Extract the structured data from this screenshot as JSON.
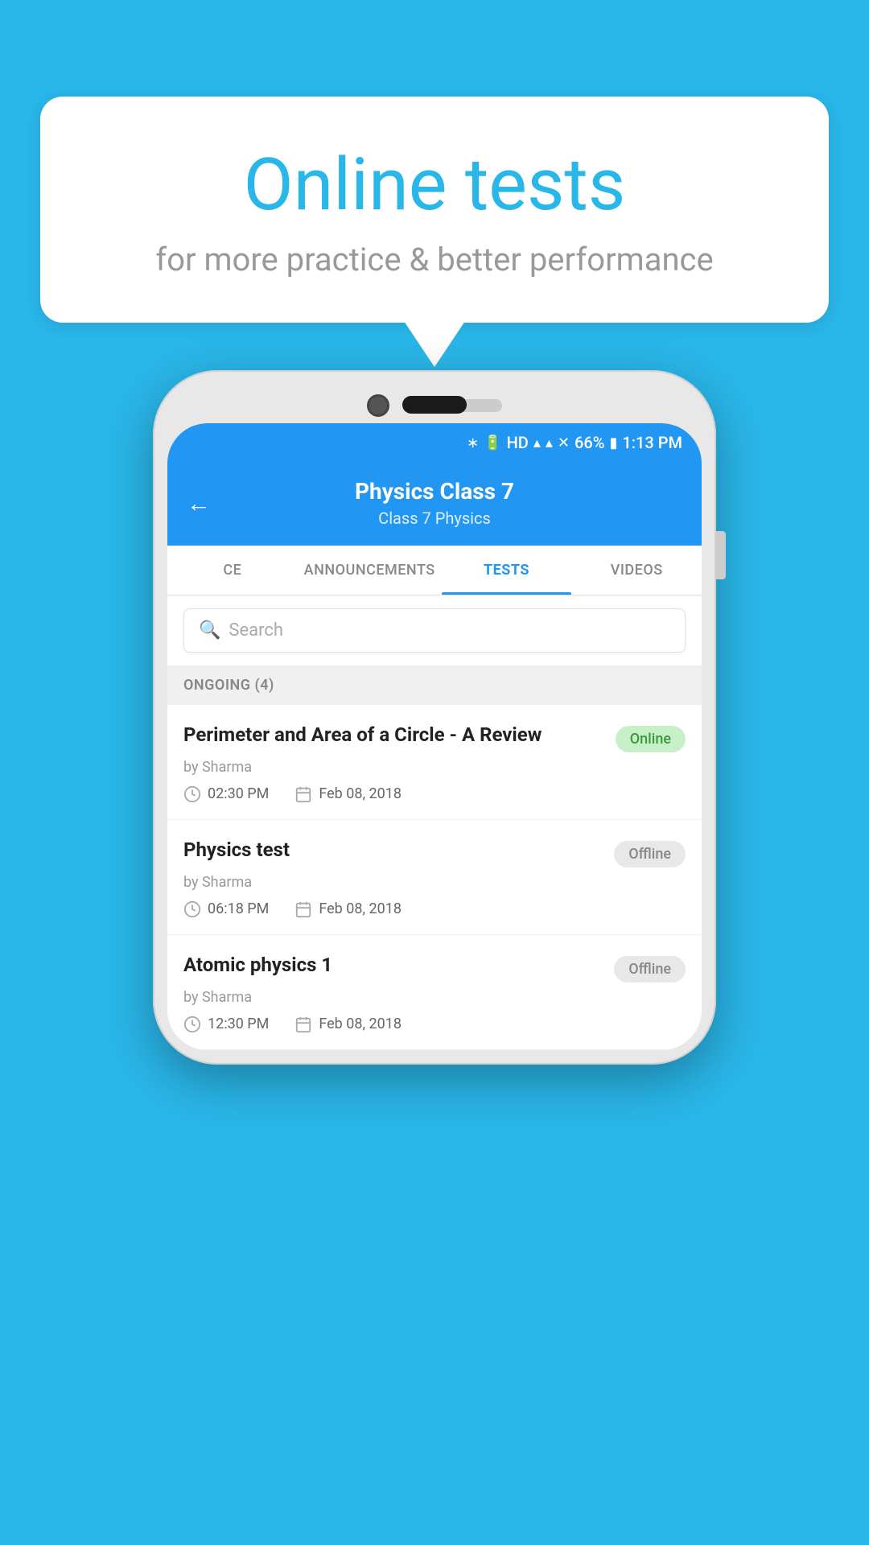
{
  "background": {
    "color": "#29b6e8"
  },
  "speech_bubble": {
    "title": "Online tests",
    "subtitle": "for more practice & better performance"
  },
  "phone": {
    "status_bar": {
      "battery": "66%",
      "time": "1:13 PM",
      "icons": [
        "bluetooth",
        "vibrate",
        "hd",
        "wifi",
        "signal",
        "x-signal",
        "battery"
      ]
    },
    "header": {
      "back_label": "←",
      "title": "Physics Class 7",
      "subtitle": "Class 7   Physics"
    },
    "tabs": [
      {
        "label": "CE",
        "active": false
      },
      {
        "label": "ANNOUNCEMENTS",
        "active": false
      },
      {
        "label": "TESTS",
        "active": true
      },
      {
        "label": "VIDEOS",
        "active": false
      }
    ],
    "search": {
      "placeholder": "Search"
    },
    "section": {
      "label": "ONGOING (4)"
    },
    "tests": [
      {
        "title": "Perimeter and Area of a Circle - A Review",
        "badge": "Online",
        "badge_type": "online",
        "author": "by Sharma",
        "time": "02:30 PM",
        "date": "Feb 08, 2018"
      },
      {
        "title": "Physics test",
        "badge": "Offline",
        "badge_type": "offline",
        "author": "by Sharma",
        "time": "06:18 PM",
        "date": "Feb 08, 2018"
      },
      {
        "title": "Atomic physics 1",
        "badge": "Offline",
        "badge_type": "offline",
        "author": "by Sharma",
        "time": "12:30 PM",
        "date": "Feb 08, 2018"
      }
    ]
  }
}
